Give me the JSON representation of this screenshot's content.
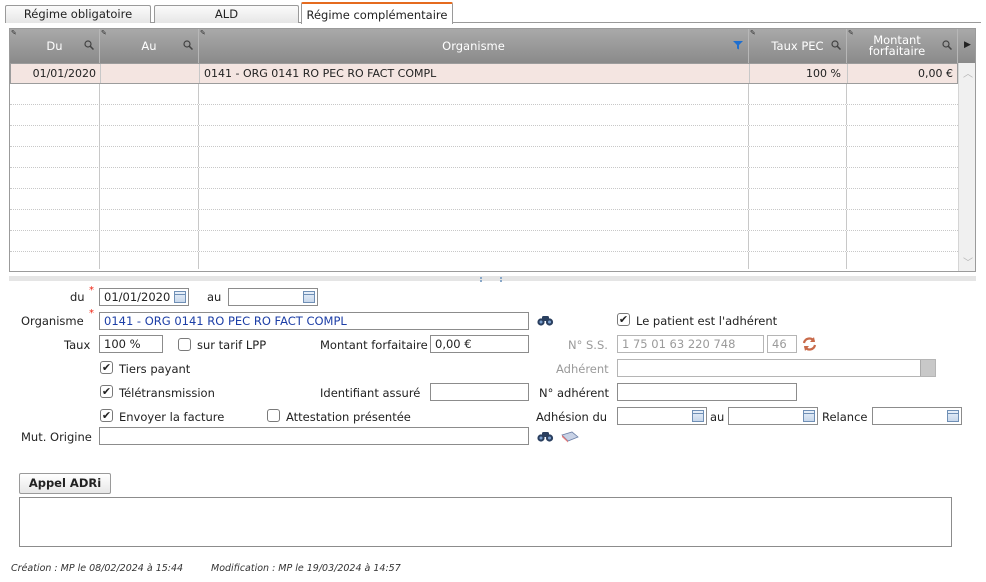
{
  "tabs": [
    {
      "label": "Régime obligatoire",
      "active": false
    },
    {
      "label": "ALD",
      "active": false
    },
    {
      "label": "Régime complémentaire",
      "active": true
    }
  ],
  "grid": {
    "columns": [
      "Du",
      "Au",
      "Organisme",
      "Taux PEC",
      "Montant forfaitaire"
    ],
    "rows": [
      {
        "du": "01/01/2020",
        "au": "",
        "organisme": "0141 - ORG 0141 RO PEC RO FACT COMPL",
        "taux": "100 %",
        "montant": "0,00 €"
      }
    ]
  },
  "form": {
    "du_label": "du",
    "du_value": "01/01/2020",
    "au_label": "au",
    "au_value": "",
    "organisme_label": "Organisme",
    "organisme_value": "0141 - ORG 0141 RO PEC RO FACT COMPL",
    "patient_adherent_label": "Le patient est l'adhérent",
    "taux_label": "Taux",
    "taux_value": "100 %",
    "sur_tarif_label": "sur tarif LPP",
    "montant_label": "Montant forfaitaire",
    "montant_value": "0,00 €",
    "nss_label": "N° S.S.",
    "nss_value": "1 75 01 63 220 748",
    "nss_key": "46",
    "tiers_payant_label": "Tiers payant",
    "adherent_label": "Adhérent",
    "adherent_value": "",
    "teletransmission_label": "Télétransmission",
    "identifiant_label": "Identifiant assuré",
    "identifiant_value": "",
    "num_adherent_label": "N° adhérent",
    "num_adherent_value": "",
    "envoyer_label": "Envoyer la facture",
    "attestation_label": "Attestation présentée",
    "adhesion_du_label": "Adhésion du",
    "adhesion_du_value": "",
    "adhesion_au_label": "au",
    "adhesion_au_value": "",
    "relance_label": "Relance",
    "relance_value": "",
    "mut_origine_label": "Mut. Origine",
    "mut_origine_value": "",
    "appel_button": "Appel ADRi",
    "checkboxes": {
      "patient_adherent": true,
      "sur_tarif": false,
      "tiers_payant": true,
      "teletransmission": true,
      "envoyer": true,
      "attestation": false
    }
  },
  "footer": {
    "creation": "Création : MP le 08/02/2024 à 15:44",
    "modification": "Modification : MP le 19/03/2024 à 14:57"
  },
  "colors": {
    "accent": "#e56b1f",
    "header_bg": "#8a8a8a",
    "selected_row": "#f4e5e1",
    "link_blue": "#1c3ea6"
  }
}
